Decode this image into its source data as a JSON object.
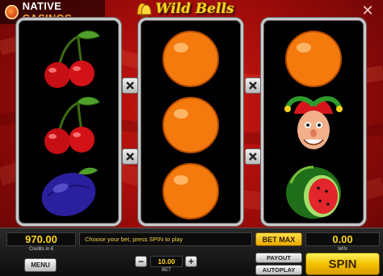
{
  "brand": {
    "name_part1": "NATIVE",
    "name_part2": " CASINOS"
  },
  "game": {
    "title": "Wild Bells"
  },
  "reels": [
    {
      "symbols": [
        "cherries",
        "cherries",
        "plum"
      ]
    },
    {
      "symbols": [
        "orange",
        "orange",
        "orange"
      ]
    },
    {
      "symbols": [
        "orange",
        "jester",
        "watermelon"
      ]
    }
  ],
  "hold_buttons": {
    "label": "X",
    "count": 4
  },
  "panel": {
    "credits_value": "970.00",
    "credits_label": "Credits in €",
    "message": "Choose your bet, press SPIN to play",
    "bet_max_label": "BET MAX",
    "win_value": "0.00",
    "win_label": "WIN",
    "menu_label": "MENU",
    "bet_minus": "−",
    "bet_plus": "+",
    "bet_value": "10.00",
    "bet_label": "BET",
    "payout_label": "PAYOUT",
    "autoplay_label": "AUTOPLAY",
    "spin_label": "SPIN"
  },
  "colors": {
    "background": "#b5100c",
    "panel_text": "#ffd41a",
    "spin_button": "#f2c200"
  }
}
